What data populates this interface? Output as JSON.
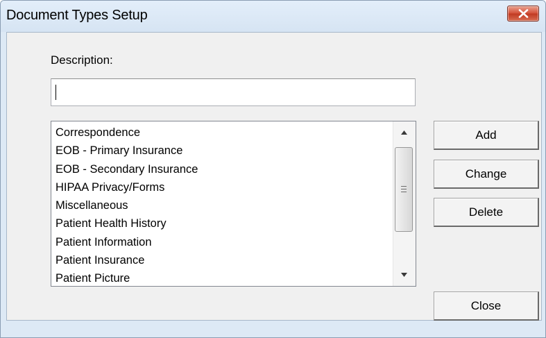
{
  "window": {
    "title": "Document Types Setup"
  },
  "form": {
    "description_label": "Description:",
    "description_value": ""
  },
  "list": {
    "items": [
      "Correspondence",
      "EOB - Primary Insurance",
      "EOB - Secondary Insurance",
      "HIPAA Privacy/Forms",
      "Miscellaneous",
      "Patient Health History",
      "Patient Information",
      "Patient Insurance",
      "Patient Picture"
    ]
  },
  "buttons": {
    "add": "Add",
    "change": "Change",
    "delete": "Delete",
    "close": "Close"
  },
  "icons": {
    "window_close": "close-icon",
    "scroll_up": "scroll-up-arrow-icon",
    "scroll_down": "scroll-down-arrow-icon",
    "thumb_grip": "grip-icon"
  },
  "colors": {
    "frame": "#dde9f5",
    "client": "#f0f0f0",
    "close_button": "#c84a32"
  }
}
